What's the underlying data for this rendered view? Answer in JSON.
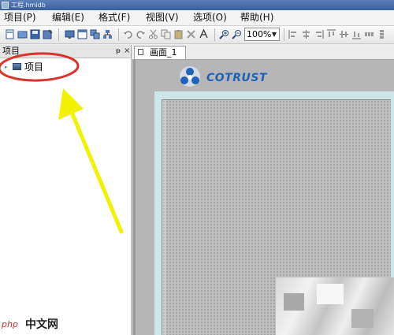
{
  "window": {
    "title": "工程.hmidb"
  },
  "menu": [
    {
      "label": "项目(P)",
      "id": "project"
    },
    {
      "label": "编辑(E)",
      "id": "edit"
    },
    {
      "label": "格式(F)",
      "id": "format"
    },
    {
      "label": "视图(V)",
      "id": "view"
    },
    {
      "label": "选项(O)",
      "id": "options"
    },
    {
      "label": "帮助(H)",
      "id": "help"
    }
  ],
  "toolbar": {
    "zoom": "100%"
  },
  "project_panel": {
    "title": "项目",
    "pin": "ᵽ",
    "close": "×",
    "tree": [
      {
        "label": "项目"
      }
    ]
  },
  "tabs": [
    {
      "label": "画面_1",
      "active": true
    }
  ],
  "canvas": {
    "logo_text": "COTRUST",
    "accent": "#1e63b8",
    "frame_color": "#cde6e8"
  },
  "watermark": {
    "site": "中文网",
    "brand": "php"
  },
  "annotations": {
    "ellipse_color": "#d9342b",
    "arrow_color": "#f2f200"
  }
}
